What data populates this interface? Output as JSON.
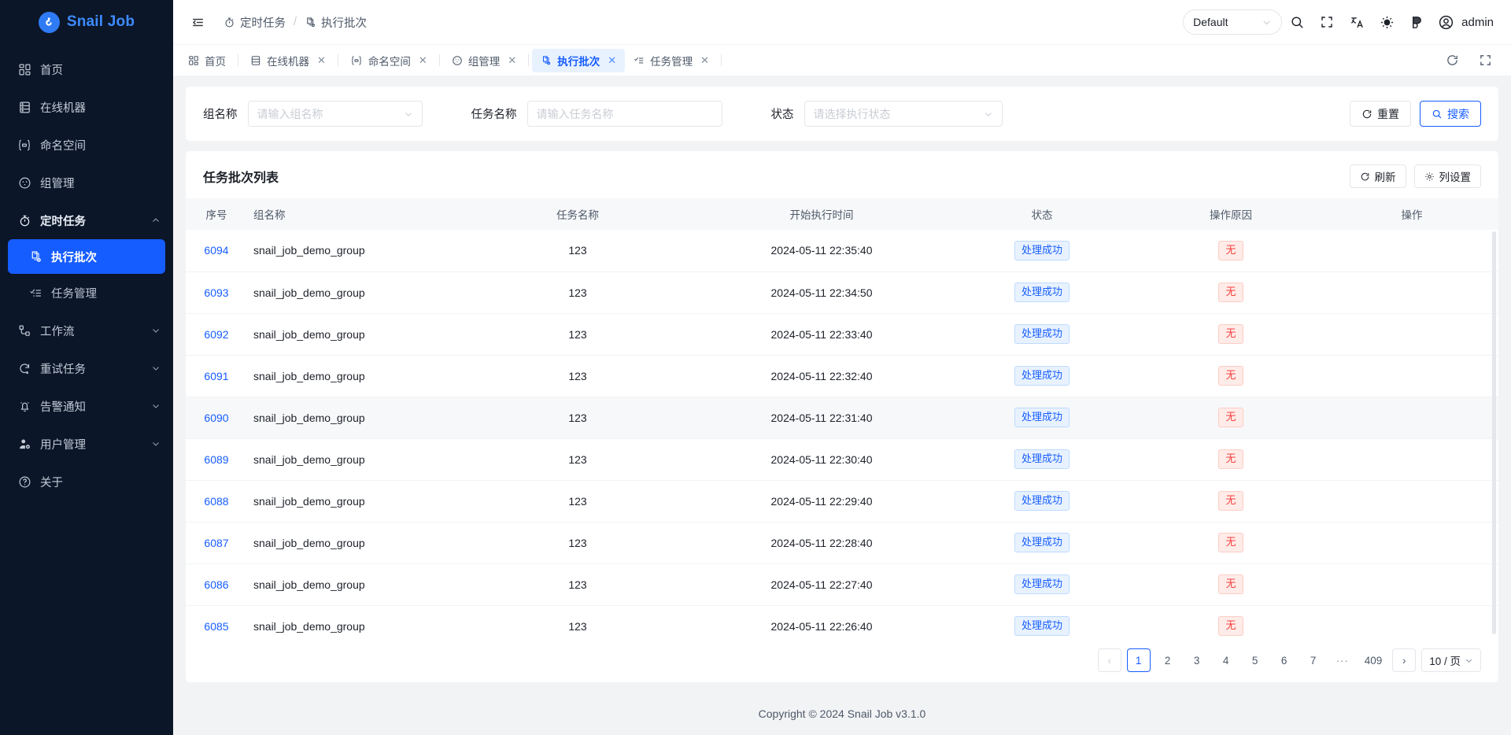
{
  "brand": {
    "name": "Snail Job",
    "logo_icon": "snail-logo-icon"
  },
  "sidebar": {
    "items": [
      {
        "label": "首页",
        "icon": "grid-icon",
        "expandable": false,
        "active": false
      },
      {
        "label": "在线机器",
        "icon": "server-icon",
        "expandable": false,
        "active": false
      },
      {
        "label": "命名空间",
        "icon": "namespace-icon",
        "expandable": false,
        "active": false
      },
      {
        "label": "组管理",
        "icon": "group-icon",
        "expandable": false,
        "active": false
      },
      {
        "label": "定时任务",
        "icon": "timer-icon",
        "expandable": true,
        "expanded": true,
        "active": false
      }
    ],
    "submenu": [
      {
        "label": "执行批次",
        "icon": "batch-icon",
        "active": true
      },
      {
        "label": "任务管理",
        "icon": "task-list-icon",
        "active": false
      }
    ],
    "items_after": [
      {
        "label": "工作流",
        "icon": "workflow-icon",
        "expandable": true
      },
      {
        "label": "重试任务",
        "icon": "retry-icon",
        "expandable": true
      },
      {
        "label": "告警通知",
        "icon": "bell-icon",
        "expandable": true
      },
      {
        "label": "用户管理",
        "icon": "user-gear-icon",
        "expandable": true
      },
      {
        "label": "关于",
        "icon": "question-circle-icon",
        "expandable": false
      }
    ]
  },
  "topbar": {
    "collapse_icon": "collapse-menu-icon",
    "breadcrumb": [
      {
        "label": "定时任务",
        "icon": "timer-icon"
      },
      {
        "label": "执行批次",
        "icon": "batch-icon"
      }
    ],
    "breadcrumb_separator": "/",
    "namespace_value": "Default",
    "icons": [
      "search-icon",
      "fullscreen-icon",
      "translate-icon",
      "sun-icon",
      "theme-palette-icon"
    ],
    "user_name": "admin",
    "user_icon": "user-circle-icon"
  },
  "tabbar": {
    "tabs": [
      {
        "label": "首页",
        "icon": "grid-icon",
        "closable": false,
        "active": false
      },
      {
        "label": "在线机器",
        "icon": "server-icon",
        "closable": true,
        "active": false
      },
      {
        "label": "命名空间",
        "icon": "namespace-icon",
        "closable": true,
        "active": false
      },
      {
        "label": "组管理",
        "icon": "group-icon",
        "closable": true,
        "active": false
      },
      {
        "label": "执行批次",
        "icon": "batch-icon",
        "closable": true,
        "active": true
      },
      {
        "label": "任务管理",
        "icon": "task-list-icon",
        "closable": true,
        "active": false
      }
    ],
    "close_glyph": "✕",
    "refresh_icon": "refresh-icon",
    "expand_icon": "expand-icon"
  },
  "filters": {
    "group": {
      "label": "组名称",
      "placeholder": "请输入组名称",
      "value": ""
    },
    "job": {
      "label": "任务名称",
      "placeholder": "请输入任务名称",
      "value": ""
    },
    "status": {
      "label": "状态",
      "placeholder": "请选择执行状态",
      "value": ""
    },
    "reset_label": "重置",
    "search_label": "搜索",
    "reset_icon": "refresh-icon",
    "search_icon": "search-icon"
  },
  "table": {
    "title": "任务批次列表",
    "refresh_label": "刷新",
    "columns_label": "列设置",
    "refresh_icon": "refresh-icon",
    "columns_icon": "gear-icon",
    "headers": [
      "序号",
      "组名称",
      "任务名称",
      "开始执行时间",
      "状态",
      "操作原因",
      "操作"
    ],
    "rows": [
      {
        "seq": "6094",
        "group": "snail_job_demo_group",
        "job": "123",
        "time": "2024-05-11 22:35:40",
        "status": "处理成功",
        "reason": "无",
        "action": ""
      },
      {
        "seq": "6093",
        "group": "snail_job_demo_group",
        "job": "123",
        "time": "2024-05-11 22:34:50",
        "status": "处理成功",
        "reason": "无",
        "action": ""
      },
      {
        "seq": "6092",
        "group": "snail_job_demo_group",
        "job": "123",
        "time": "2024-05-11 22:33:40",
        "status": "处理成功",
        "reason": "无",
        "action": ""
      },
      {
        "seq": "6091",
        "group": "snail_job_demo_group",
        "job": "123",
        "time": "2024-05-11 22:32:40",
        "status": "处理成功",
        "reason": "无",
        "action": ""
      },
      {
        "seq": "6090",
        "group": "snail_job_demo_group",
        "job": "123",
        "time": "2024-05-11 22:31:40",
        "status": "处理成功",
        "reason": "无",
        "action": ""
      },
      {
        "seq": "6089",
        "group": "snail_job_demo_group",
        "job": "123",
        "time": "2024-05-11 22:30:40",
        "status": "处理成功",
        "reason": "无",
        "action": ""
      },
      {
        "seq": "6088",
        "group": "snail_job_demo_group",
        "job": "123",
        "time": "2024-05-11 22:29:40",
        "status": "处理成功",
        "reason": "无",
        "action": ""
      },
      {
        "seq": "6087",
        "group": "snail_job_demo_group",
        "job": "123",
        "time": "2024-05-11 22:28:40",
        "status": "处理成功",
        "reason": "无",
        "action": ""
      },
      {
        "seq": "6086",
        "group": "snail_job_demo_group",
        "job": "123",
        "time": "2024-05-11 22:27:40",
        "status": "处理成功",
        "reason": "无",
        "action": ""
      },
      {
        "seq": "6085",
        "group": "snail_job_demo_group",
        "job": "123",
        "time": "2024-05-11 22:26:40",
        "status": "处理成功",
        "reason": "无",
        "action": ""
      }
    ],
    "highlight_row_index": 4
  },
  "pagination": {
    "prev_glyph": "‹",
    "next_glyph": "›",
    "pages": [
      "1",
      "2",
      "3",
      "4",
      "5",
      "6",
      "7"
    ],
    "ellipsis": "···",
    "last_page": "409",
    "current": "1",
    "page_size_label": "10 / 页"
  },
  "footer": {
    "text": "Copyright © 2024 Snail Job v3.1.0"
  },
  "colors": {
    "accent": "#165dff",
    "sidebar_bg": "#0b1628",
    "badge_blue_bg": "#e8f2ff",
    "badge_red_bg": "#ffece8",
    "badge_red_fg": "#f53f3f"
  }
}
